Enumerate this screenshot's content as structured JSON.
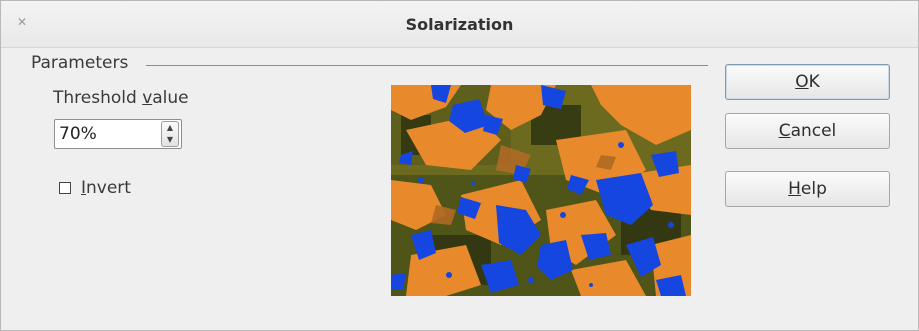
{
  "window": {
    "title": "Solarization",
    "close_glyph": "✕"
  },
  "parameters": {
    "group_label": "Parameters",
    "threshold": {
      "label_before": "Threshold ",
      "label_accel": "v",
      "label_after": "alue",
      "value": "70%",
      "spin_up_glyph": "▲",
      "spin_down_glyph": "▼"
    },
    "invert": {
      "checked": false,
      "label_accel": "I",
      "label_after": "nvert"
    }
  },
  "preview": {
    "icon": "solarized-image-preview",
    "colors": {
      "orange": "#e8892c",
      "blue": "#1646e0",
      "olive": "#6b6a1f",
      "dark": "#2f3412"
    }
  },
  "buttons": {
    "ok": {
      "accel": "O",
      "rest": "K"
    },
    "cancel": {
      "accel": "C",
      "rest": "ancel"
    },
    "help": {
      "accel": "H",
      "rest": "elp"
    }
  }
}
